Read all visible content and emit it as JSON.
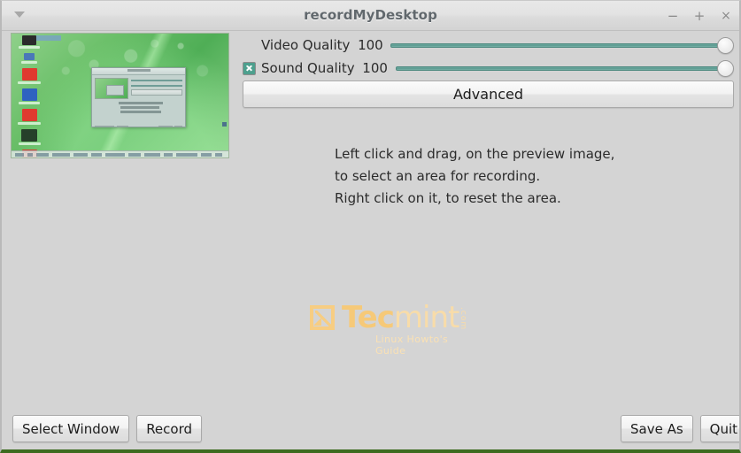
{
  "window": {
    "title": "recordMyDesktop",
    "menu_icon": "chevron-down-icon",
    "minimize_label": "−",
    "maximize_label": "+",
    "close_label": "×"
  },
  "controls": {
    "video": {
      "label": "Video Quality",
      "value": "100",
      "has_checkbox": false
    },
    "sound": {
      "label": "Sound Quality",
      "value": "100",
      "has_checkbox": true,
      "checkbox_checked": true
    },
    "advanced_label": "Advanced"
  },
  "hints": {
    "line1": "Left click and drag, on the preview image,",
    "line2": "to select an area for recording.",
    "line3": "Right click on it, to reset the area."
  },
  "watermark": {
    "tec": "Tec",
    "mint": "mint",
    "dotcom": ".com",
    "tagline": "Linux Howto's Guide"
  },
  "buttons": {
    "select_window": "Select Window",
    "record": "Record",
    "save_as": "Save As",
    "quit": "Quit"
  },
  "colors": {
    "window_bg": "#d4d4d4",
    "titlebar": "#e3e3e3",
    "title_text": "#61686d",
    "slider_track": "#5d9b91",
    "checkbox_fill": "#4da08e",
    "bottom_border": "#3d6b1f",
    "watermark": "#f6c978",
    "desktop_green": "#6cc06a"
  }
}
